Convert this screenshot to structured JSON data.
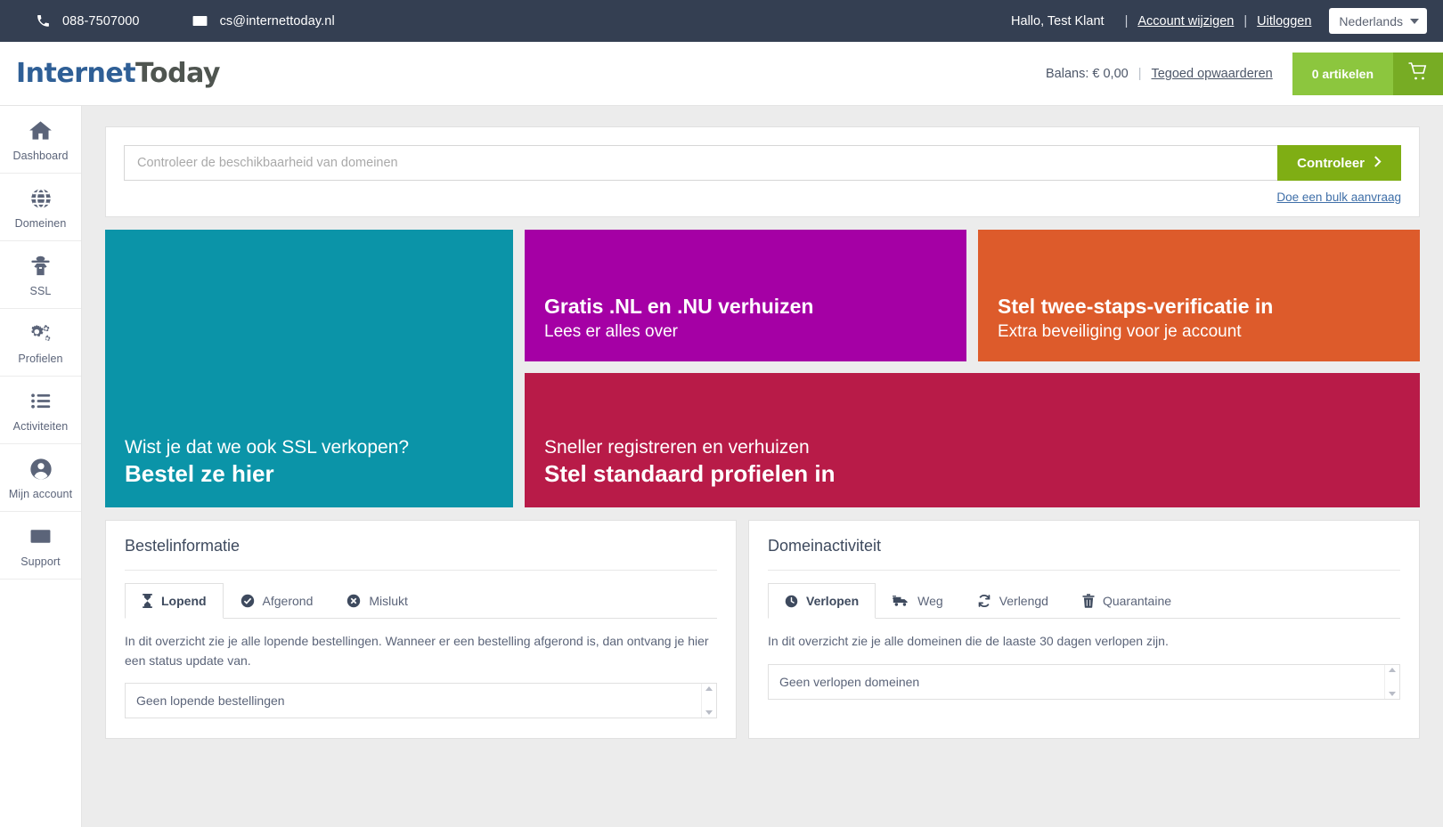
{
  "topbar": {
    "phone": "088-7507000",
    "phone_icon": "phone-icon",
    "email": "cs@internettoday.nl",
    "email_icon": "envelope-icon",
    "greeting": "Hallo, Test Klant",
    "sep1": "|",
    "sep2": "|",
    "account_link": "Account wijzigen",
    "logout_link": "Uitloggen",
    "language": "Nederlands"
  },
  "brand": {
    "logo_part1": "Internet",
    "logo_part2": "Today",
    "color_primary": "#2f5f96",
    "color_secondary": "#4f5550"
  },
  "account_bar": {
    "balance_label": "Balans: € 0,00",
    "separator": "|",
    "topup_link": "Tegoed opwaarderen",
    "cart_count": "0 artikelen",
    "cart_icon": "shopping-cart-icon",
    "cart_color": "#8cc63e"
  },
  "sidebar": {
    "items": [
      {
        "label": "Dashboard",
        "icon": "home-icon"
      },
      {
        "label": "Domeinen",
        "icon": "globe-icon"
      },
      {
        "label": "SSL",
        "icon": "user-secret-icon"
      },
      {
        "label": "Profielen",
        "icon": "gears-icon"
      },
      {
        "label": "Activiteiten",
        "icon": "list-icon"
      },
      {
        "label": "Mijn account",
        "icon": "user-circle-icon"
      },
      {
        "label": "Support",
        "icon": "envelope-icon"
      }
    ]
  },
  "search": {
    "placeholder": "Controleer de beschikbaarheid van domeinen",
    "value": "",
    "button_label": "Controleer",
    "button_icon": "chevron-right-icon",
    "button_color": "#7fae14",
    "bulk_link": "Doe een bulk aanvraag"
  },
  "tiles": [
    {
      "id": "ssl",
      "sub": "Wist je dat we ook SSL verkopen?",
      "main": "Bestel ze hier",
      "color": "#0b94a8"
    },
    {
      "id": "transfer",
      "main": "Gratis .NL en .NU verhuizen",
      "sub": "Lees er alles over",
      "color": "#a500a5"
    },
    {
      "id": "two-factor",
      "main": "Stel twee-staps-verificatie in",
      "sub": "Extra beveiliging voor je account",
      "color": "#dd5b2b"
    },
    {
      "id": "profiles",
      "sub": "Sneller registreren en verhuizen",
      "main": "Stel standaard profielen in",
      "color": "#b81b48"
    }
  ],
  "order_panel": {
    "title": "Bestelinformatie",
    "tabs": [
      {
        "label": "Lopend",
        "icon": "hourglass-icon",
        "active": true
      },
      {
        "label": "Afgerond",
        "icon": "check-circle-icon",
        "active": false
      },
      {
        "label": "Mislukt",
        "icon": "times-circle-icon",
        "active": false
      }
    ],
    "description": "In dit overzicht zie je alle lopende bestellingen. Wanneer er een bestelling afgerond is, dan ontvang je hier een status update van.",
    "empty_text": "Geen lopende bestellingen"
  },
  "domain_panel": {
    "title": "Domeinactiviteit",
    "tabs": [
      {
        "label": "Verlopen",
        "icon": "clock-icon",
        "active": true
      },
      {
        "label": "Weg",
        "icon": "truck-icon",
        "active": false
      },
      {
        "label": "Verlengd",
        "icon": "refresh-icon",
        "active": false
      },
      {
        "label": "Quarantaine",
        "icon": "trash-icon",
        "active": false
      }
    ],
    "description": "In dit overzicht zie je alle domeinen die de laaste 30 dagen verlopen zijn.",
    "empty_text": "Geen verlopen domeinen"
  }
}
